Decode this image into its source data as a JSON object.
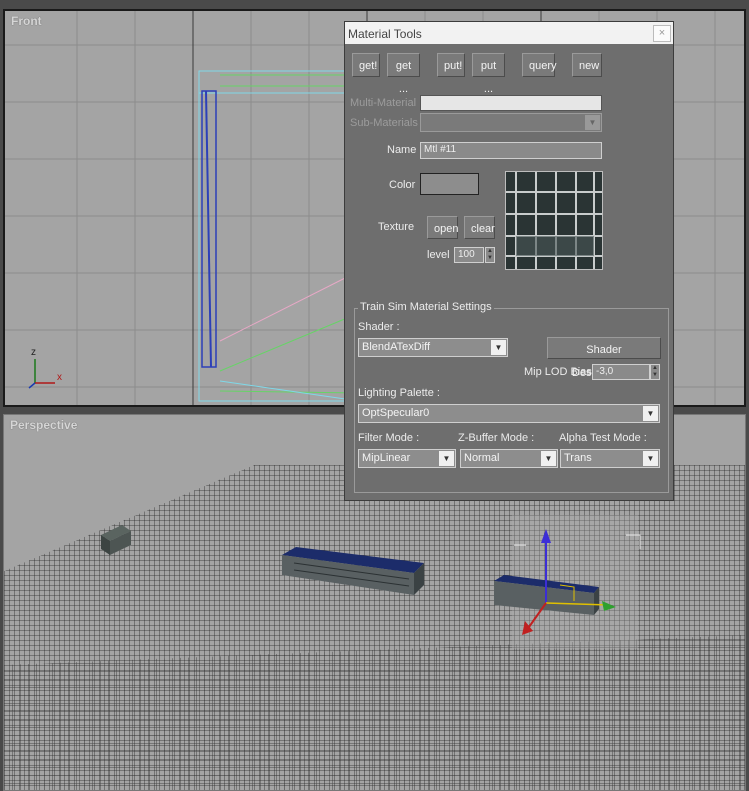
{
  "viewports": {
    "front_label": "Front",
    "perspective_label": "Perspective",
    "axis_z": "z",
    "axis_x": "x"
  },
  "dialog": {
    "title": "Material Tools",
    "close_glyph": "×",
    "toolbar": {
      "get": "get!",
      "get_more": "get ...",
      "put": "put!",
      "put_more": "put ...",
      "query": "query",
      "new": "new"
    },
    "multi_material_label": "Multi-Material",
    "multi_material_value": "",
    "sub_materials_label": "Sub-Materials",
    "sub_materials_value": "",
    "name_label": "Name",
    "name_value": "Mtl #11",
    "color_label": "Color",
    "color_value": "#8d8d8d",
    "texture_label": "Texture",
    "open_label": "open",
    "clear_label": "clear",
    "level_label": "level",
    "level_value": "100",
    "group": {
      "title": "Train Sim Material Settings",
      "shader_label": "Shader :",
      "shader_value": "BlendATexDiff",
      "shader_desc_button": "Shader Description...",
      "mip_lod_label": "Mip LOD Bias",
      "mip_lod_value": "-3,0",
      "lighting_label": "Lighting Palette :",
      "lighting_value": "OptSpecular0",
      "filter_label": "Filter Mode :",
      "filter_value": "MipLinear",
      "zbuffer_label": "Z-Buffer Mode :",
      "zbuffer_value": "Normal",
      "alpha_label": "Alpha Test Mode :",
      "alpha_value": "Trans"
    }
  },
  "icons": {
    "dropdown": "▼",
    "spin_up": "▲",
    "spin_down": "▼"
  },
  "colors": {
    "viewport_bg": "#a4a4a4",
    "dialog_bg": "#6e6e6e",
    "wire_cyan": "#7fd8e8",
    "wire_green": "#66d466",
    "wire_blue": "#2c3fb8",
    "grid_dark": "#222222"
  }
}
